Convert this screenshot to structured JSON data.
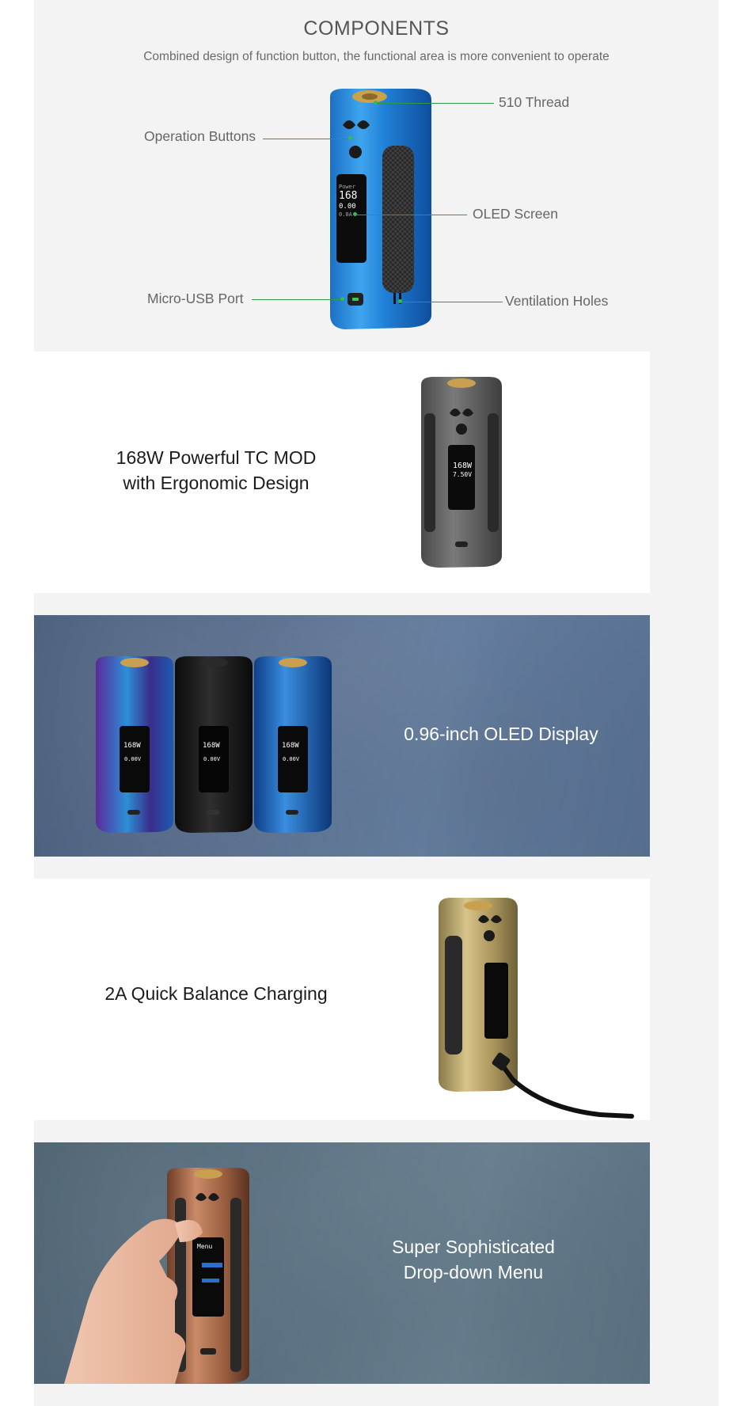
{
  "components": {
    "title": "COMPONENTS",
    "subtitle": "Combined design of function button, the functional area is more convenient to operate",
    "callouts": {
      "thread": "510 Thread",
      "buttons": "Operation Buttons",
      "screen": "OLED Screen",
      "usb": "Micro-USB Port",
      "vent": "Ventilation Holes"
    },
    "screen": {
      "mode": "Power",
      "value": "168",
      "line2": "0.00",
      "line3": "0.0A"
    }
  },
  "features": [
    {
      "line1": "168W Powerful TC MOD",
      "line2": "with Ergonomic Design",
      "screen_value": "168W",
      "screen_volt": "7.50V"
    },
    {
      "line1": "0.96-inch OLED Display",
      "screen_value": "168W",
      "screen_volt": "0.00V"
    },
    {
      "line1": "2A Quick Balance Charging"
    },
    {
      "line1": "Super Sophisticated",
      "line2": "Drop-down Menu",
      "menu_title": "Menu"
    }
  ],
  "colors": {
    "page_bg": "#f3f3f3",
    "leader_line": "#2e9a4a",
    "panel_blue": "#5a6f8e",
    "panel_teal": "#5a7080"
  }
}
